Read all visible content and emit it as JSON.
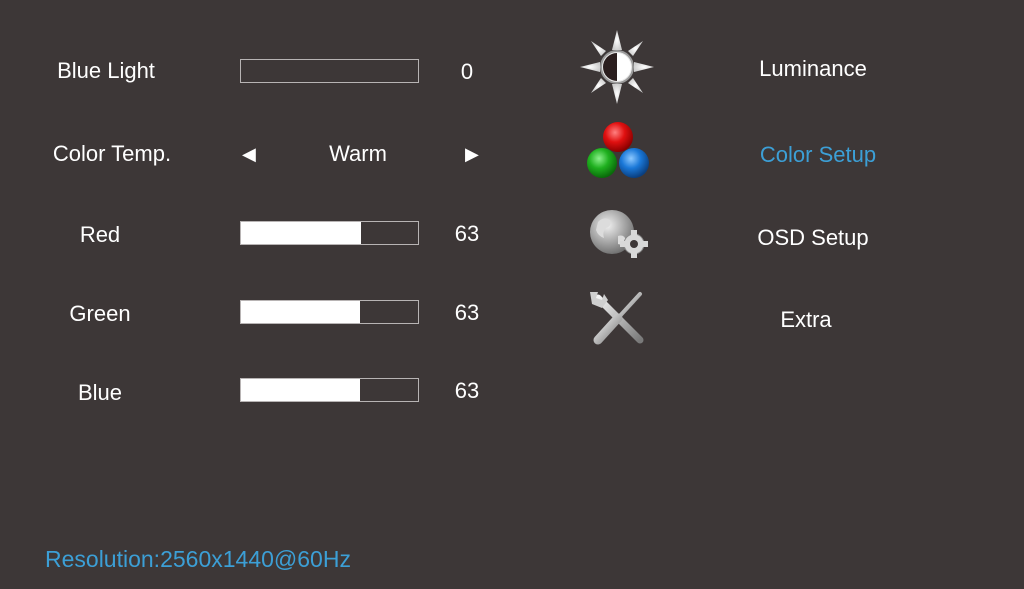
{
  "settings": {
    "blue_light": {
      "label": "Blue Light",
      "value": "0",
      "fill_fraction": 0.0
    },
    "color_temp": {
      "label": "Color Temp.",
      "value": "Warm",
      "left_arrow": "◀",
      "right_arrow": "▶"
    },
    "red": {
      "label": "Red",
      "value": "63",
      "fill_fraction": 0.68
    },
    "green": {
      "label": "Green",
      "value": "63",
      "fill_fraction": 0.67
    },
    "blue": {
      "label": "Blue",
      "value": "63",
      "fill_fraction": 0.67
    }
  },
  "menu": {
    "items": [
      {
        "label": "Luminance",
        "icon": "sun-contrast-icon",
        "active": false
      },
      {
        "label": "Color Setup",
        "icon": "rgb-balls-icon",
        "active": true
      },
      {
        "label": "OSD Setup",
        "icon": "globe-gear-icon",
        "active": false
      },
      {
        "label": "Extra",
        "icon": "wrench-screwdriver-icon",
        "active": false
      }
    ]
  },
  "status": {
    "resolution": "Resolution:2560x1440@60Hz"
  },
  "colors": {
    "accent": "#3c9fd6",
    "background": "#3d3737",
    "text": "#ffffff"
  }
}
